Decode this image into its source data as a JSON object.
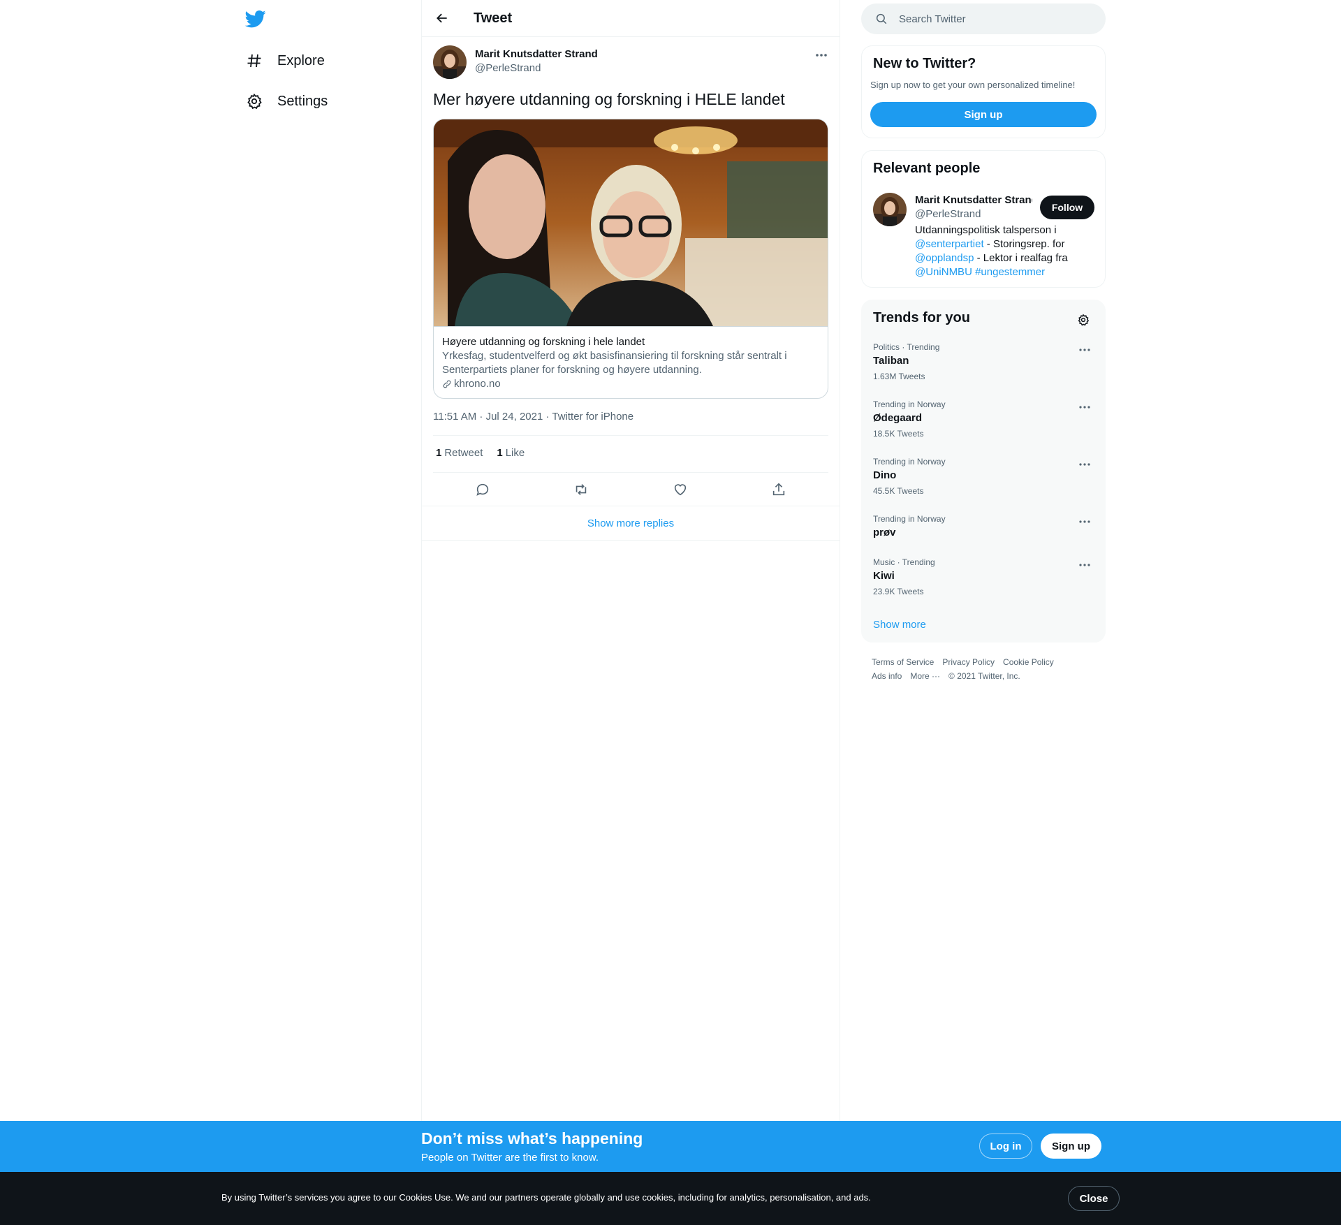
{
  "nav": {
    "logo": "twitter-bird-icon",
    "items": [
      {
        "label": "Explore",
        "icon": "hashtag-icon"
      },
      {
        "label": "Settings",
        "icon": "gear-icon"
      }
    ]
  },
  "header": {
    "title": "Tweet"
  },
  "tweet": {
    "author_name": "Marit Knutsdatter Strand",
    "author_handle": "@PerleStrand",
    "text": "Mer høyere utdanning og forskning i HELE landet",
    "card": {
      "title": "Høyere utdanning og forskning i hele landet",
      "description": "Yrkesfag, studentvelferd og økt basisfinansiering til forskning står sentralt i Senterpartiets planer for forskning og høyere utdanning.",
      "domain": "khrono.no"
    },
    "meta": "11:51 AM · Jul 24, 2021 · Twitter for iPhone",
    "retweets_count": "1",
    "retweets_label": "Retweet",
    "likes_count": "1",
    "likes_label": "Like",
    "show_more_replies": "Show more replies"
  },
  "search": {
    "placeholder": "Search Twitter"
  },
  "new_to_twitter": {
    "title": "New to Twitter?",
    "subtitle": "Sign up now to get your own personalized timeline!",
    "button": "Sign up"
  },
  "relevant_people": {
    "title": "Relevant people",
    "name": "Marit Knutsdatter Strand",
    "handle": "@PerleStrand",
    "follow": "Follow",
    "bio": {
      "t1": "Utdanningspolitisk talsperson i ",
      "l1": "@senterpartiet",
      "t2": " - Storingsrep. for ",
      "l2": "@opplandsp",
      "t3": " - Lektor i realfag fra ",
      "l3": "@UniNMBU",
      "t4": " ",
      "l4": "#ungestemmer"
    }
  },
  "trends": {
    "title": "Trends for you",
    "items": [
      {
        "context": "Politics · Trending",
        "name": "Taliban",
        "count": "1.63M Tweets"
      },
      {
        "context": "Trending in Norway",
        "name": "Ødegaard",
        "count": "18.5K Tweets"
      },
      {
        "context": "Trending in Norway",
        "name": "Dino",
        "count": "45.5K Tweets"
      },
      {
        "context": "Trending in Norway",
        "name": "prøv",
        "count": ""
      },
      {
        "context": "Music · Trending",
        "name": "Kiwi",
        "count": "23.9K Tweets"
      }
    ],
    "show_more": "Show more"
  },
  "footer": {
    "links": [
      "Terms of Service",
      "Privacy Policy",
      "Cookie Policy",
      "Ads info",
      "More ···"
    ],
    "copyright": "© 2021 Twitter, Inc."
  },
  "banner": {
    "title": "Don’t miss what’s happening",
    "subtitle": "People on Twitter are the first to know.",
    "login": "Log in",
    "signup": "Sign up"
  },
  "cookie": {
    "text_a": "By using Twitter’s services you agree to our ",
    "link": "Cookies Use",
    "text_b": ". We and our partners operate globally and use cookies, including for analytics, personalisation, and ads.",
    "close": "Close"
  },
  "colors": {
    "accent": "#1d9bf0",
    "text": "#0f1419",
    "secondary": "#536471",
    "border": "#eff3f4"
  }
}
